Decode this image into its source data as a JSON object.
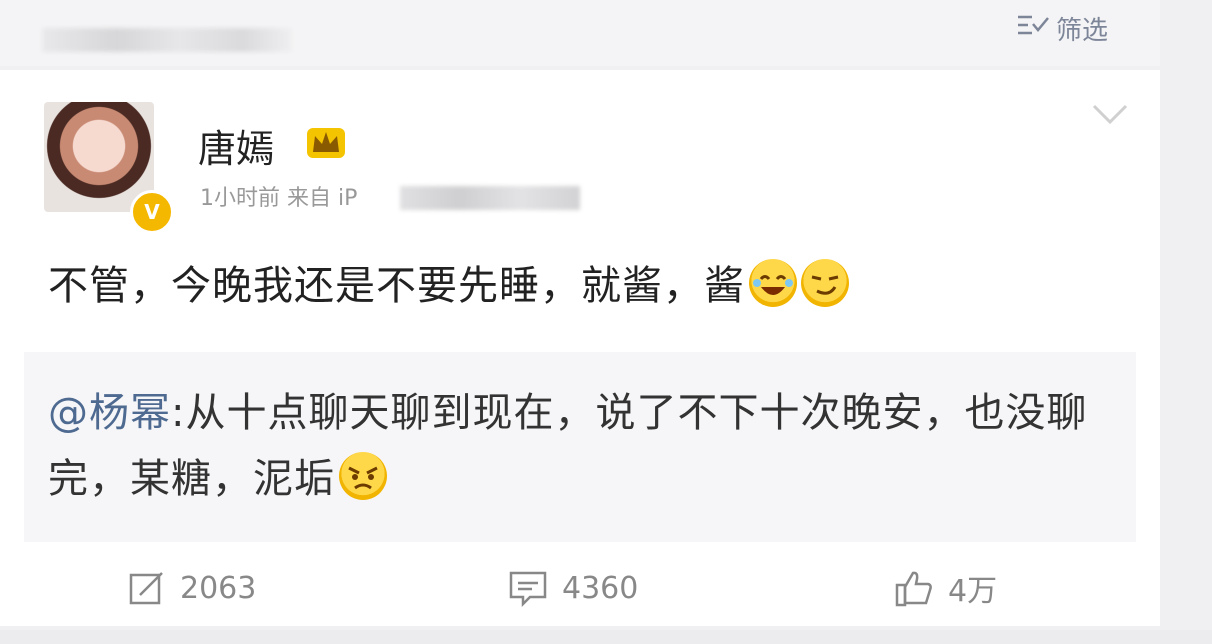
{
  "header": {
    "filter_label": "筛选"
  },
  "post": {
    "username": "唐嫣",
    "meta": "1小时前 来自 iP",
    "text": "不管，今晚我还是不要先睡，就酱，酱",
    "emojis": [
      "laughing-tears-emoji",
      "smirk-emoji"
    ]
  },
  "repost": {
    "mention": "@杨幂",
    "text": ":从十点聊天聊到现在，说了不下十次晚安，也没聊完，某糖，泥垢",
    "emoji": "angry-emoji"
  },
  "actions": {
    "share_count": "2063",
    "comment_count": "4360",
    "like_count": "4万"
  },
  "colors": {
    "mention": "#4e6a91",
    "badge": "#f5b800",
    "meta_text": "#999999"
  }
}
